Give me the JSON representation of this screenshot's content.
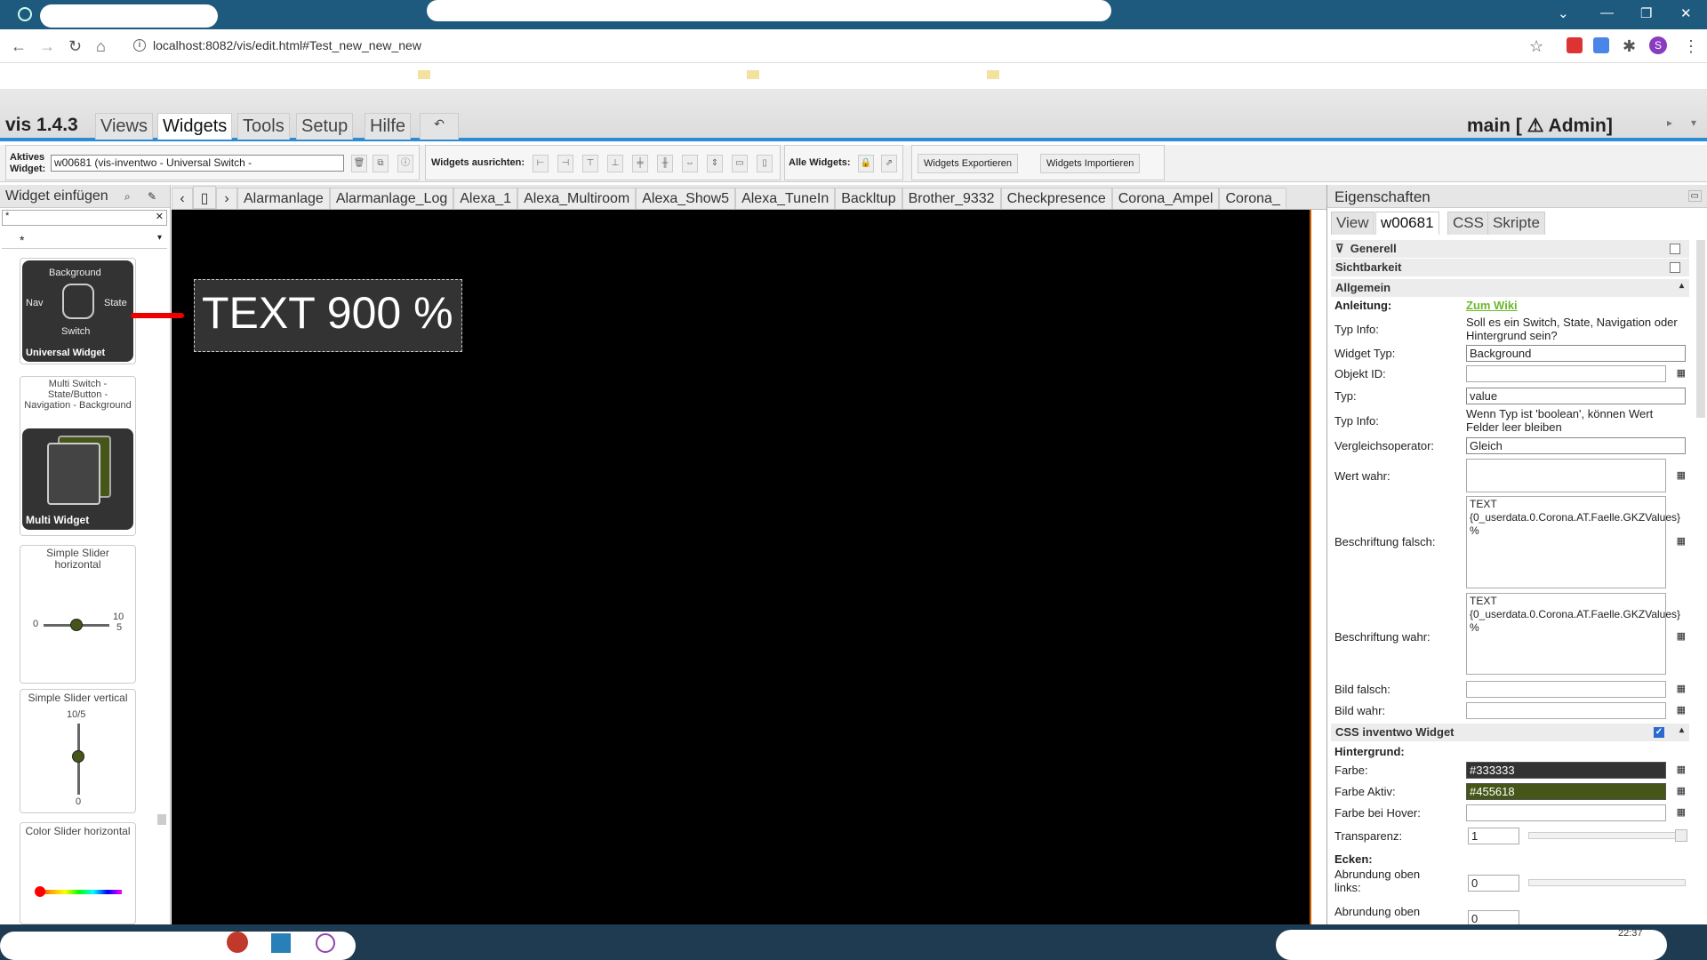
{
  "browser": {
    "url": "localhost:8082/vis/edit.html#Test_new_new_new",
    "profile_initial": "S"
  },
  "menu": {
    "app_name": "vis 1.4.3",
    "tabs": [
      "Views",
      "Widgets",
      "Tools",
      "Setup",
      "Hilfe"
    ],
    "user": "main [ ⚠ Admin]"
  },
  "toolbar": {
    "active_widget_label": "Aktives Widget:",
    "active_widget_value": "w00681 (vis-inventwo - Universal Switch -",
    "align_label": "Widgets ausrichten:",
    "all_label": "Alle Widgets:",
    "export": "Widgets Exportieren",
    "import": "Widgets Importieren"
  },
  "left": {
    "title": "Widget einfügen",
    "search": "*",
    "filter": "*",
    "cards": [
      {
        "top_labels": [
          "Background",
          "Nav",
          "State",
          "Switch"
        ],
        "name": "Universal Widget"
      },
      {
        "title": "Multi Switch - State/Button - Navigation - Background",
        "name": "Multi Widget"
      },
      {
        "title": "Simple Slider horizontal",
        "min": "0",
        "max": "10",
        "max2": "5"
      },
      {
        "title": "Simple Slider vertical",
        "top": "10/5",
        "bottom": "0"
      },
      {
        "title": "Color Slider horizontal"
      }
    ]
  },
  "views": [
    "Alarmanlage",
    "Alarmanlage_Log",
    "Alexa_1",
    "Alexa_Multiroom",
    "Alexa_Show5",
    "Alexa_TuneIn",
    "Backltup",
    "Brother_9332",
    "Checkpresence",
    "Corona_Ampel",
    "Corona_"
  ],
  "canvas": {
    "widget_text": "TEXT 900 %"
  },
  "props": {
    "title": "Eigenschaften",
    "tabs": [
      "View",
      "w00681",
      "CSS",
      "Skripte"
    ],
    "generell": "Generell",
    "sichtbarkeit": "Sichtbarkeit",
    "allgemein": "Allgemein",
    "anleitung_label": "Anleitung:",
    "anleitung_link": "Zum Wiki",
    "typinfo_label": "Typ Info:",
    "typinfo1": "Soll es ein Switch, State, Navigation oder Hintergrund sein?",
    "widget_typ_label": "Widget Typ:",
    "widget_typ": "Background",
    "objekt_label": "Objekt ID:",
    "typ_label": "Typ:",
    "typ": "value",
    "typinfo2": "Wenn Typ ist 'boolean', können Wert Felder leer bleiben",
    "vergleich_label": "Vergleichsoperator:",
    "vergleich": "Gleich",
    "wert_wahr_label": "Wert wahr:",
    "beschr_falsch_label": "Beschriftung falsch:",
    "beschr_falsch": "TEXT {0_userdata.0.Corona.AT.Faelle.GKZValues} %",
    "beschr_wahr_label": "Beschriftung wahr:",
    "beschr_wahr": "TEXT {0_userdata.0.Corona.AT.Faelle.GKZValues} %",
    "bild_falsch_label": "Bild falsch:",
    "bild_wahr_label": "Bild wahr:",
    "css_section": "CSS inventwo Widget",
    "hintergrund": "Hintergrund:",
    "farbe_label": "Farbe:",
    "farbe": "#333333",
    "farbe_color": "#333333",
    "farbe_aktiv_label": "Farbe Aktiv:",
    "farbe_aktiv": "#455618",
    "farbe_aktiv_color": "#455618",
    "farbe_hover_label": "Farbe bei Hover:",
    "transparenz_label": "Transparenz:",
    "transparenz": "1",
    "ecken": "Ecken:",
    "abr_ol_label": "Abrundung oben links:",
    "abr_ol": "0",
    "abr_or_label": "Abrundung oben",
    "abr_or": "0"
  },
  "taskbar": {
    "time": "22:37"
  }
}
